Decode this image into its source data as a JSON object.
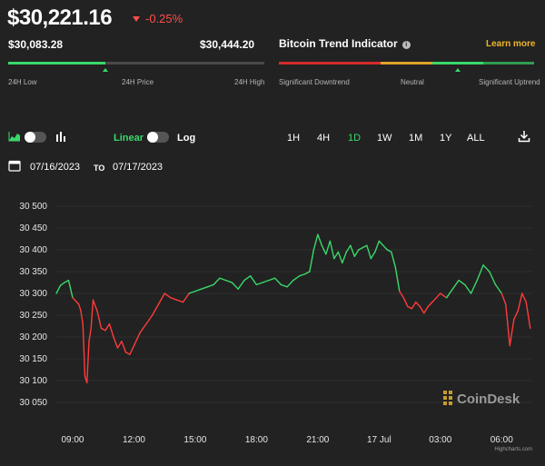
{
  "header": {
    "price": "$30,221.16",
    "change": "-0.25%",
    "colors": {
      "up": "#39d96a",
      "down": "#ff3b3b",
      "accent": "#f0b429"
    }
  },
  "range": {
    "low_value": "$30,083.28",
    "high_value": "$30,444.20",
    "low_label": "24H Low",
    "price_label": "24H Price",
    "high_label": "24H High",
    "price_position": 0.38
  },
  "trend": {
    "title": "Bitcoin Trend Indicator",
    "learn_more": "Learn more",
    "left_label": "Significant Downtrend",
    "mid_label": "Neutral",
    "right_label": "Significant Uptrend",
    "level": 0.7
  },
  "controls": {
    "linear": "Linear",
    "log": "Log",
    "timeframes": [
      "1H",
      "4H",
      "1D",
      "1W",
      "1M",
      "1Y",
      "ALL"
    ],
    "active_timeframe": "1D",
    "date_from": "07/16/2023",
    "date_to_label": "TO",
    "date_to": "07/17/2023",
    "icons": [
      "area-chart-icon",
      "bar-chart-icon",
      "calendar-icon",
      "download-icon"
    ]
  },
  "chart_data": {
    "type": "line",
    "title": "",
    "xlabel": "",
    "ylabel": "",
    "ylim": [
      30050,
      30500
    ],
    "y_ticks": [
      "30 500",
      "30 450",
      "30 400",
      "30 350",
      "30 300",
      "30 250",
      "30 200",
      "30 150",
      "30 100",
      "30 050"
    ],
    "y_tick_values": [
      30500,
      30450,
      30400,
      30350,
      30300,
      30250,
      30200,
      30150,
      30100,
      30050
    ],
    "x_ticks": [
      "09:00",
      "12:00",
      "15:00",
      "18:00",
      "21:00",
      "17 Jul",
      "03:00",
      "06:00"
    ],
    "x_tick_hours": [
      9,
      12,
      15,
      18,
      21,
      24,
      27,
      30
    ],
    "xlim_hours": [
      8.2,
      31.5
    ],
    "reference_price": 30300,
    "series": [
      {
        "x": [
          8.2,
          8.4,
          8.6,
          8.8,
          8.9,
          9.0,
          9.1,
          9.2,
          9.3,
          9.4,
          9.5,
          9.6,
          9.7,
          9.8,
          9.9,
          10.0,
          10.2,
          10.4,
          10.6,
          10.8,
          11.0,
          11.2,
          11.4,
          11.6,
          11.8,
          12.0,
          12.3,
          12.6,
          12.9,
          13.2,
          13.5,
          13.8,
          14.1,
          14.4,
          14.7,
          15.0,
          15.3,
          15.6,
          15.9,
          16.2,
          16.5,
          16.8,
          17.1,
          17.4,
          17.7,
          18.0,
          18.3,
          18.6,
          18.9,
          19.2,
          19.5,
          19.8,
          20.1,
          20.4,
          20.6,
          20.8,
          21.0,
          21.2,
          21.4,
          21.6,
          21.8,
          22.0,
          22.2,
          22.4,
          22.6,
          22.8,
          23.0,
          23.2,
          23.4,
          23.6,
          23.8,
          24.0,
          24.2,
          24.4,
          24.6,
          24.8,
          25.0,
          25.2,
          25.4,
          25.6,
          25.8,
          26.0,
          26.2,
          26.4,
          26.6,
          26.8,
          27.0,
          27.3,
          27.6,
          27.9,
          28.2,
          28.5,
          28.8,
          29.1,
          29.4,
          29.7,
          30.0,
          30.2,
          30.4,
          30.6,
          30.8,
          31.0,
          31.2,
          31.4
        ],
        "y": [
          30300,
          30318,
          30325,
          30330,
          30310,
          30290,
          30285,
          30280,
          30275,
          30260,
          30230,
          30110,
          30095,
          30190,
          30220,
          30285,
          30260,
          30220,
          30215,
          30230,
          30200,
          30175,
          30190,
          30165,
          30160,
          30180,
          30210,
          30230,
          30250,
          30275,
          30300,
          30290,
          30285,
          30280,
          30300,
          30305,
          30310,
          30315,
          30320,
          30335,
          30330,
          30325,
          30310,
          30330,
          30340,
          30320,
          30325,
          30330,
          30335,
          30320,
          30315,
          30330,
          30340,
          30345,
          30350,
          30400,
          30435,
          30410,
          30390,
          30420,
          30380,
          30395,
          30370,
          30395,
          30410,
          30385,
          30400,
          30405,
          30410,
          30380,
          30395,
          30420,
          30410,
          30400,
          30395,
          30360,
          30305,
          30290,
          30270,
          30265,
          30280,
          30270,
          30255,
          30270,
          30280,
          30290,
          30300,
          30290,
          30310,
          30330,
          30320,
          30300,
          30330,
          30365,
          30350,
          30320,
          30300,
          30275,
          30180,
          30240,
          30260,
          30300,
          30280,
          30220
        ]
      }
    ]
  },
  "watermark": {
    "brand": "CoinDesk",
    "credit": "Highcharts.com"
  }
}
